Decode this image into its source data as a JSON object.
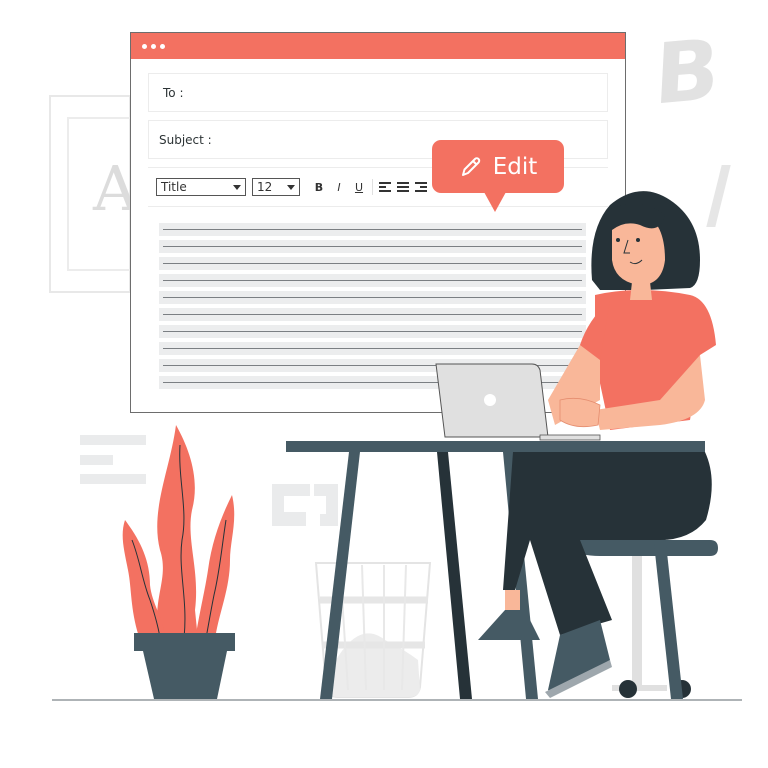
{
  "scene": {
    "description": "Illustration of a woman editing an email on a laptop",
    "colors": {
      "accent": "#f37161",
      "dark": "#263238",
      "furniture": "#455a64",
      "skin": "#f9b799",
      "light_gray": "#e0e0e0"
    }
  },
  "background": {
    "letter_a": "A",
    "letter_b": "B",
    "slash": "/"
  },
  "window": {
    "controls": [
      "dot",
      "dot",
      "dot"
    ],
    "to_label": "To :",
    "subject_label": "Subject :",
    "toolbar": {
      "style_select": "Title",
      "size_select": "12",
      "bold": "B",
      "italic": "I",
      "underline": "U",
      "align_left": "align-left-icon",
      "align_center": "align-center-icon",
      "align_right": "align-right-icon"
    },
    "body_line_count": 10
  },
  "edit_bubble": {
    "icon": "pencil-icon",
    "label": "Edit"
  }
}
